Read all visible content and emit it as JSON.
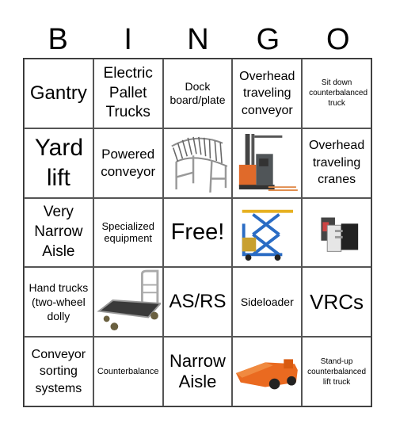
{
  "header": {
    "letters": [
      "B",
      "I",
      "N",
      "G",
      "O"
    ]
  },
  "cells": [
    {
      "text": "Gantry"
    },
    {
      "text": "Electric Pallet Trucks"
    },
    {
      "text": "Dock board/plate"
    },
    {
      "text": "Overhead traveling conveyor"
    },
    {
      "text": "Sit down counterbalanced truck"
    },
    {
      "text": "Yard lift"
    },
    {
      "text": "Powered conveyor"
    },
    {
      "image": "curved-roller-conveyor"
    },
    {
      "image": "order-picker-forklift"
    },
    {
      "text": "Overhead traveling cranes"
    },
    {
      "text": "Very Narrow Aisle"
    },
    {
      "text": "Specialized equipment"
    },
    {
      "text": "Free!"
    },
    {
      "image": "scissor-lift-table"
    },
    {
      "image": "forklift-clamp-attachment"
    },
    {
      "text": "Hand trucks (two-wheel dolly"
    },
    {
      "image": "platform-hand-truck"
    },
    {
      "text": "AS/RS"
    },
    {
      "text": "Sideloader"
    },
    {
      "text": "VRCs"
    },
    {
      "text": "Conveyor sorting systems"
    },
    {
      "text": "Counterbalance"
    },
    {
      "text": "Narrow Aisle"
    },
    {
      "image": "orange-mining-loader"
    },
    {
      "text": "Stand-up counterbalanced lift truck"
    }
  ]
}
